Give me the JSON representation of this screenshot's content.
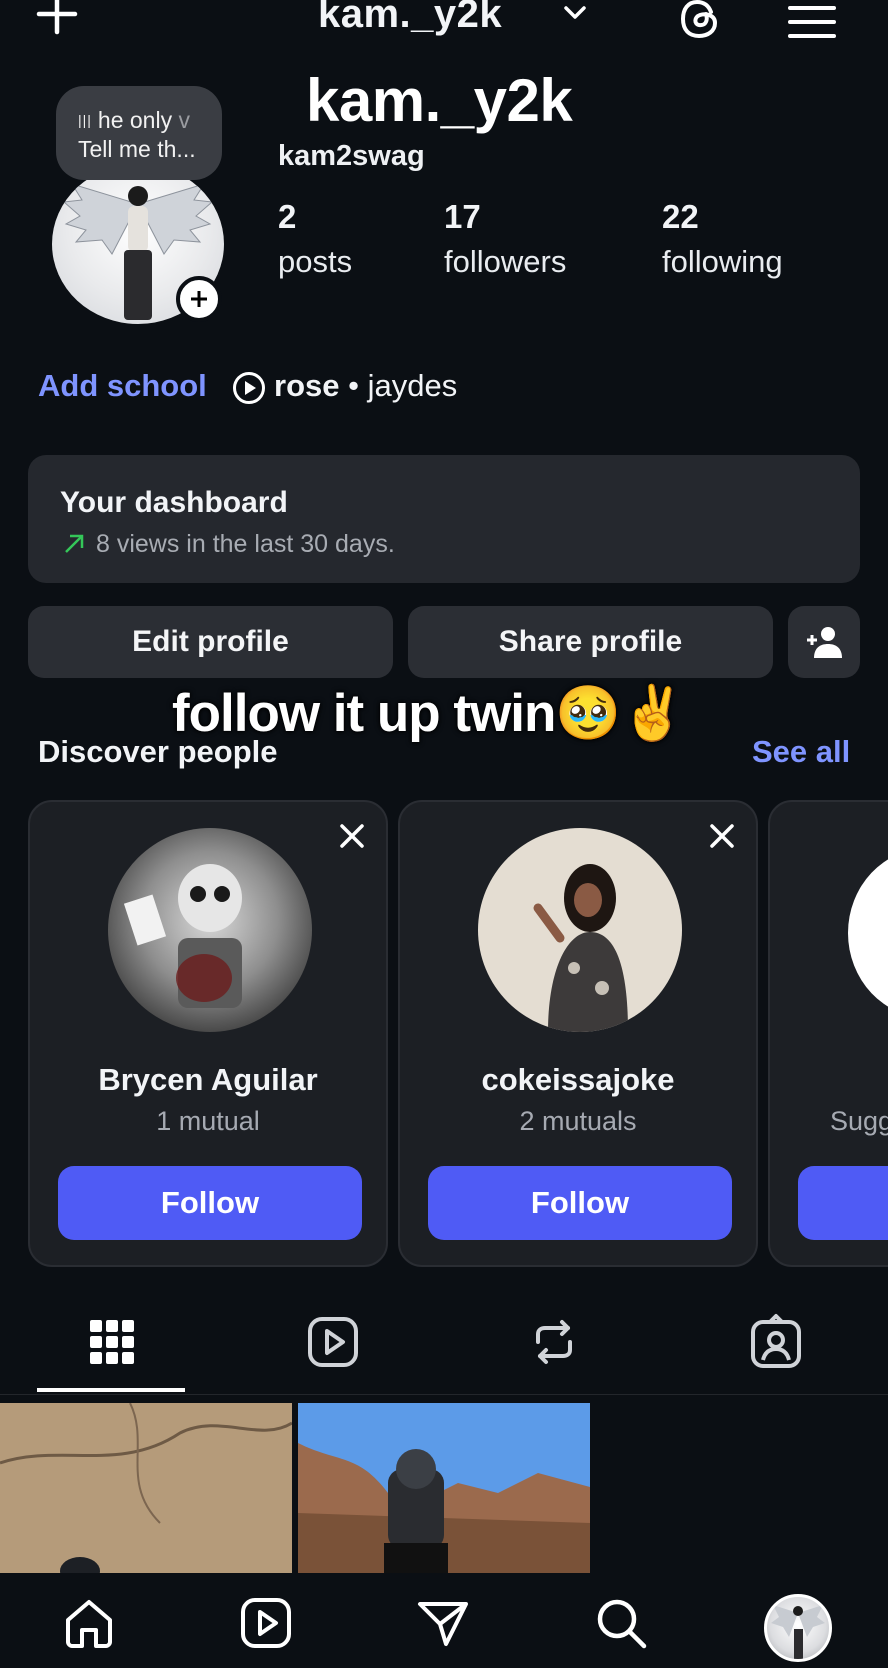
{
  "top_bar": {
    "username": "kam._y2k",
    "icons": [
      "plus-icon",
      "chevron-down-icon",
      "threads-icon",
      "menu-icon"
    ]
  },
  "overlay_title": "kam._y2k",
  "profile": {
    "handle": "kam2swag",
    "note_line1": "he only",
    "note_line1_fade": "v",
    "note_line2": "Tell me th...",
    "stats": [
      {
        "value": "2",
        "label": "posts"
      },
      {
        "value": "17",
        "label": "followers"
      },
      {
        "value": "22",
        "label": "following"
      }
    ],
    "add_school": "Add school",
    "music_song": "rose",
    "music_separator": "•",
    "music_artist": "jaydes"
  },
  "dashboard": {
    "title": "Your dashboard",
    "subtitle": "8 views in the last 30 days.",
    "arrow_color": "#34c759"
  },
  "actions": {
    "edit": "Edit profile",
    "share": "Share profile"
  },
  "caption": "follow it up twin🥹✌️",
  "discover": {
    "title": "Discover people",
    "see_all": "See all",
    "cards": [
      {
        "name": "Brycen Aguilar",
        "mutual": "1 mutual",
        "button": "Follow"
      },
      {
        "name": "cokeissajoke",
        "mutual": "2 mutuals",
        "button": "Follow"
      }
    ],
    "partial_card_text": "Sugg"
  },
  "tabs": [
    "grid-icon",
    "reels-icon",
    "reposts-icon",
    "tagged-icon"
  ],
  "bottom_nav": [
    "home-icon",
    "reels-icon",
    "send-icon",
    "search-icon",
    "profile-avatar"
  ],
  "colors": {
    "background": "#0b0f14",
    "accent_link": "#7f94ff",
    "follow_button": "#4f5bf5",
    "card": "#1c1f24",
    "button": "#2b2e34"
  }
}
